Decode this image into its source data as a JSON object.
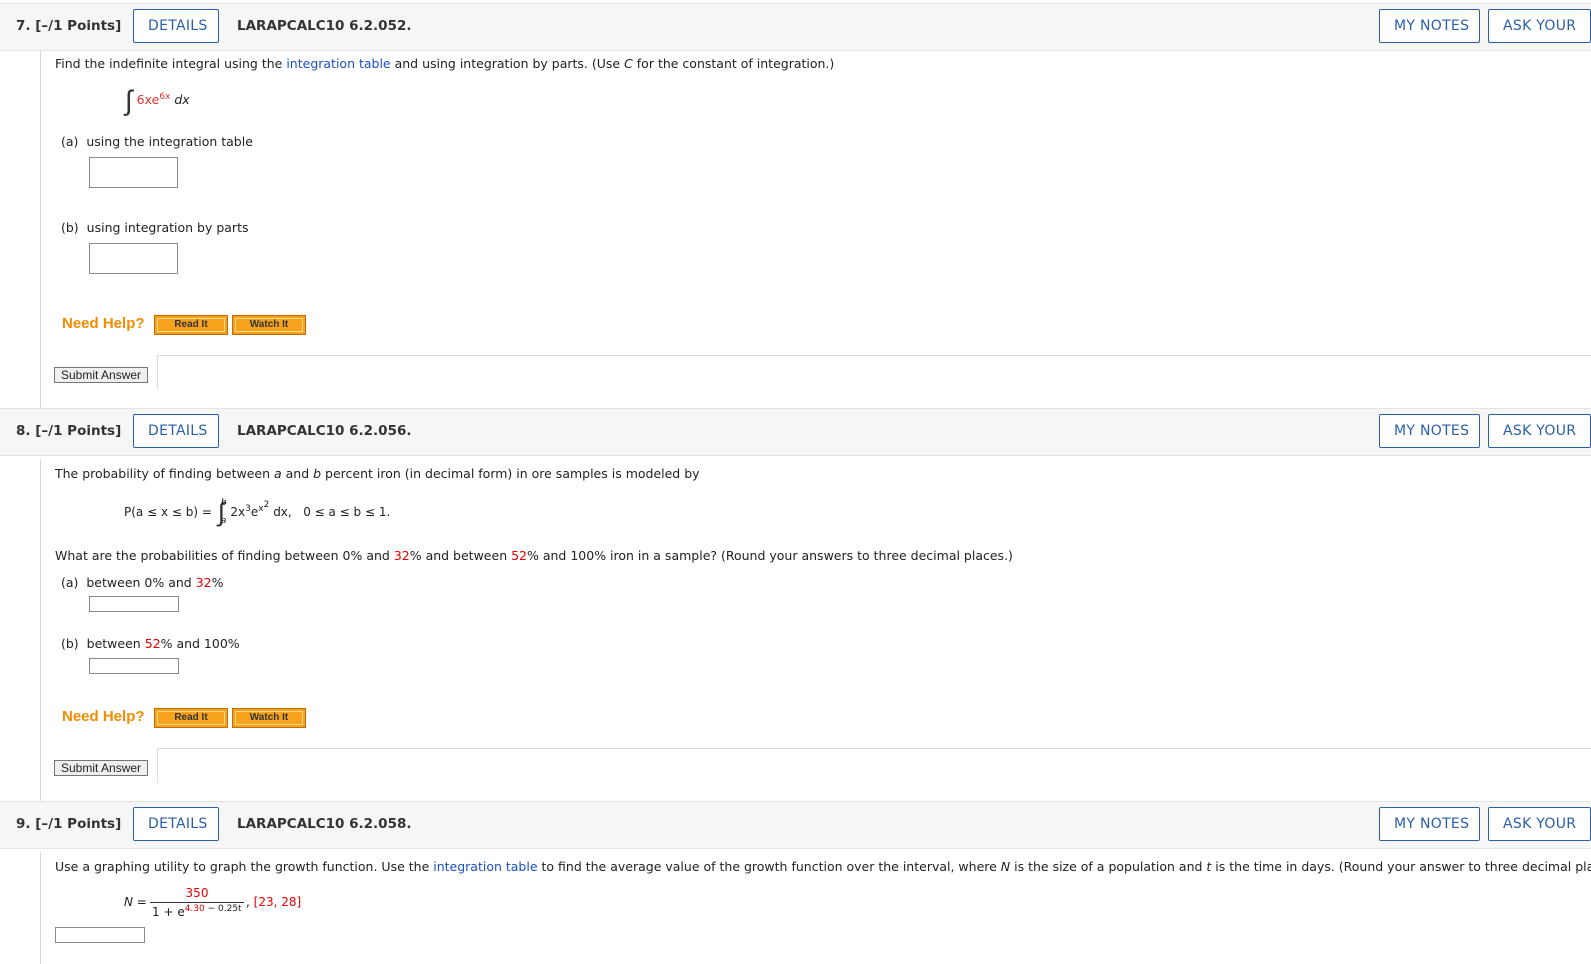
{
  "questions": [
    {
      "number": "7.",
      "points": "[–/1 Points]",
      "details_label": "DETAILS",
      "code": "LARAPCALC10 6.2.052.",
      "my_notes_label": "MY NOTES",
      "ask_label": "ASK YOUR",
      "prompt_start": "Find the indefinite integral using the ",
      "prompt_link": "integration table",
      "prompt_mid": " and using integration by parts. (Use ",
      "prompt_var": "C",
      "prompt_end": " for the constant of integration.)",
      "integrand": "6xe",
      "integrand_exp": "6x",
      "integrand_dx": "dx",
      "part_a_label": "(a)",
      "part_a_text": "using the integration table",
      "part_b_label": "(b)",
      "part_b_text": "using integration by parts",
      "need_help": "Need Help?",
      "read_it": "Read It",
      "watch_it": "Watch It",
      "submit": "Submit Answer"
    },
    {
      "number": "8.",
      "points": "[–/1 Points]",
      "details_label": "DETAILS",
      "code": "LARAPCALC10 6.2.056.",
      "my_notes_label": "MY NOTES",
      "ask_label": "ASK YOUR",
      "prompt_a": "The probability of finding between ",
      "prompt_var_a": "a",
      "prompt_and": " and ",
      "prompt_var_b": "b",
      "prompt_b": " percent iron (in decimal form) in ore samples is modeled by",
      "formula_lhs": "P(a ≤ x ≤ b) =",
      "formula_upper": "b",
      "formula_lower": "a",
      "formula_body": "2x",
      "formula_exp1": "3",
      "formula_e": "e",
      "formula_exp2": "x",
      "formula_exp3": "2",
      "formula_dx": "dx,",
      "formula_range": "0 ≤ a ≤ b ≤ 1.",
      "question_1": "What are the probabilities of finding between 0% and ",
      "question_red1": "32",
      "question_2": "% and between ",
      "question_red2": "52",
      "question_3": "% and 100% iron in a sample? (Round your answers to three decimal places.)",
      "part_a_label": "(a)",
      "part_a_1": "between 0% and ",
      "part_a_red": "32",
      "part_a_2": "%",
      "part_b_label": "(b)",
      "part_b_1": "between ",
      "part_b_red": "52",
      "part_b_2": "% and 100%",
      "need_help": "Need Help?",
      "read_it": "Read It",
      "watch_it": "Watch It",
      "submit": "Submit Answer"
    },
    {
      "number": "9.",
      "points": "[–/1 Points]",
      "details_label": "DETAILS",
      "code": "LARAPCALC10 6.2.058.",
      "my_notes_label": "MY NOTES",
      "ask_label": "ASK YOUR",
      "prompt_1": "Use a graphing utility to graph the growth function. Use the ",
      "prompt_link": "integration table",
      "prompt_2": " to find the average value of the growth function over the interval, where ",
      "prompt_var_n": "N",
      "prompt_3": " is the size of a population and ",
      "prompt_var_t": "t",
      "prompt_4": " is the time in days. (Round your answer to three decimal places.)",
      "formula_lhs": "N =",
      "formula_num": "350",
      "formula_den_1": "1 + e",
      "formula_den_exp_red": "4.30",
      "formula_den_exp_rest": " − 0.25t",
      "formula_comma": ",",
      "formula_interval": "[23, 28]"
    }
  ]
}
